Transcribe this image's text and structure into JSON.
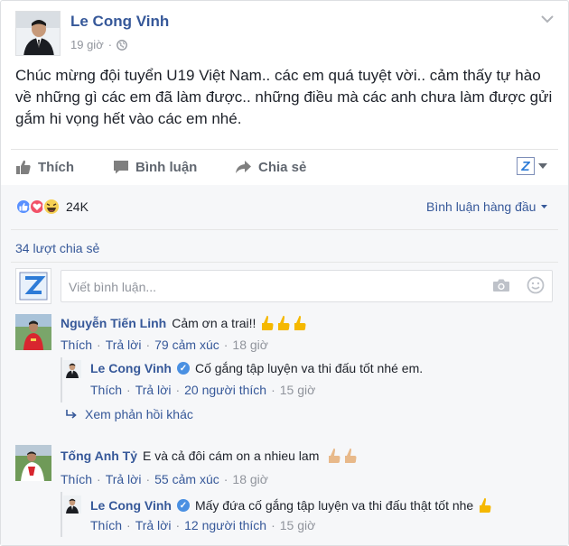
{
  "post": {
    "author": "Le Cong Vinh",
    "time": "19 giờ",
    "content": "Chúc mừng đội tuyển U19 Việt Nam.. các em quá tuyệt vời.. cảm thấy tự hào về những gì các em đã làm được.. những điều mà các anh chưa làm được gửi gắm hi vọng hết vào các em nhé."
  },
  "actions": {
    "like": "Thích",
    "comment": "Bình luận",
    "share": "Chia sẻ"
  },
  "reactions": {
    "count": "24K",
    "sort_label": "Bình luận hàng đầu"
  },
  "shares_text": "34 lượt chia sẻ",
  "composer": {
    "placeholder": "Viết bình luận..."
  },
  "comments": [
    {
      "name": "Nguyễn Tiến Linh",
      "text": "Cảm ơn a trai!!",
      "like": "Thích",
      "reply": "Trả lời",
      "reactions": "79 cảm xúc",
      "time": "18 giờ",
      "emoji_thumbs": 3,
      "thumb_color": "#f5b800"
    },
    {
      "name": "Le Cong Vinh",
      "text": "Cố gắng tập luyện va thi đấu tốt nhé em.",
      "like": "Thích",
      "reply": "Trả lời",
      "reactions": "20 người thích",
      "time": "15 giờ"
    },
    {
      "more_replies": "Xem phản hồi khác"
    },
    {
      "name": "Tống Anh Tỷ",
      "text": "E và cả đôi cám on a nhieu lam",
      "like": "Thích",
      "reply": "Trả lời",
      "reactions": "55 cảm xúc",
      "time": "18 giờ",
      "emoji_thumbs": 2,
      "thumb_color": "#e8b98a"
    },
    {
      "name": "Le Cong Vinh",
      "text": "Mấy đứa cố gắng tập luyện va thi đấu thật tốt nhe",
      "like": "Thích",
      "reply": "Trả lời",
      "reactions": "12 người thích",
      "time": "15 giờ",
      "emoji_thumbs": 1,
      "thumb_color": "#f5b800"
    }
  ],
  "colors": {
    "link": "#365899",
    "meta": "#90949c",
    "text": "#1d2129",
    "like_blue": "#5890ff",
    "love_red": "#f25268",
    "haha_yellow": "#f7d154"
  }
}
